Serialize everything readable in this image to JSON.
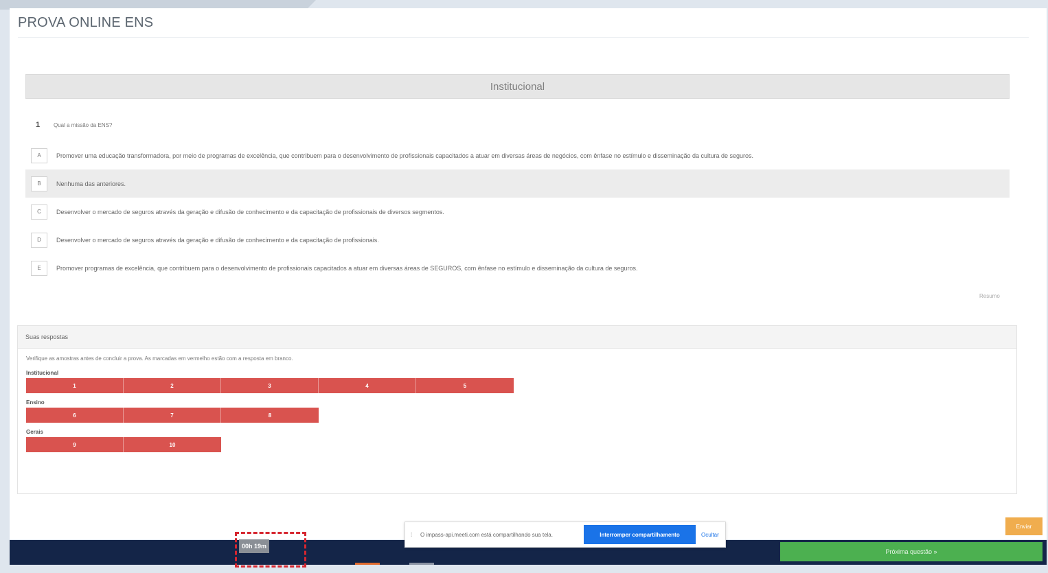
{
  "app": {
    "title": "PROVA ONLINE ENS"
  },
  "section": {
    "title": "Institucional"
  },
  "question": {
    "number": "1",
    "text": "Qual a missão da ENS?"
  },
  "options": [
    {
      "letter": "A",
      "text": "Promover uma educação transformadora, por meio de programas de excelência, que contribuem para o desenvolvimento de profissionais capacitados a atuar em diversas áreas de negócios, com ênfase no estímulo e disseminação da cultura de seguros."
    },
    {
      "letter": "B",
      "text": "Nenhuma das anteriores."
    },
    {
      "letter": "C",
      "text": "Desenvolver o mercado de seguros através da geração e difusão de conhecimento e da capacitação de profissionais de diversos segmentos."
    },
    {
      "letter": "D",
      "text": "Desenvolver o mercado de seguros através da geração e difusão de conhecimento e da capacitação de profissionais."
    },
    {
      "letter": "E",
      "text": "Promover programas de excelência, que contribuem para o desenvolvimento de profissionais capacitados a atuar em diversas áreas de SEGUROS, com ênfase no estímulo e disseminação da cultura de seguros."
    }
  ],
  "selected_option": "B",
  "small_link": "Resumo",
  "answers": {
    "header": "Suas respostas",
    "hint": "Verifique as amostras antes de concluir a prova. As marcadas em vermelho estão com a resposta em branco.",
    "groups": [
      {
        "label": "Institucional",
        "items": [
          "1",
          "2",
          "3",
          "4",
          "5"
        ]
      },
      {
        "label": "Ensino",
        "items": [
          "6",
          "7",
          "8"
        ]
      },
      {
        "label": "Gerais",
        "items": [
          "9",
          "10"
        ]
      }
    ]
  },
  "footer": {
    "timer": "00h 19m",
    "next_label": "Próxima questão »",
    "finish_label": "Enviar"
  },
  "share_bar": {
    "icon": "grip-icon",
    "text": "O impass-api.meeti.com está compartilhando sua tela.",
    "stop_label": "Interromper compartilhamento",
    "hide_label": "Ocultar"
  },
  "colors": {
    "answer_unanswered": "#d9534f",
    "footer_bg": "#142548",
    "next_button": "#4cb050",
    "stop_button": "#1a73e8",
    "finish_button": "#f0ad4e",
    "timer_highlight": "#d6262f"
  }
}
